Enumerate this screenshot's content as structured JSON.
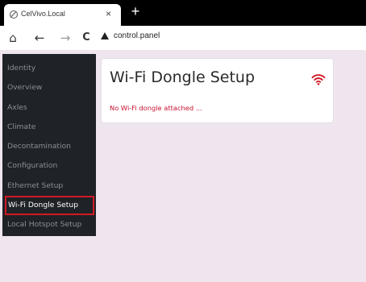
{
  "browser": {
    "tab_title": "CelVivo.Local",
    "tab_close": "×",
    "new_tab": "+",
    "address": "control.panel",
    "home_glyph": "⌂",
    "back_glyph": "←",
    "forward_glyph": "→",
    "reload_glyph": "C"
  },
  "sidebar": {
    "items": [
      {
        "label": "Identity"
      },
      {
        "label": "Overview"
      },
      {
        "label": "Axles"
      },
      {
        "label": "Climate"
      },
      {
        "label": "Decontamination"
      },
      {
        "label": "Configuration"
      },
      {
        "label": "Ethernet Setup"
      },
      {
        "label": "Wi-Fi Dongle Setup"
      },
      {
        "label": "Local Hotspot Setup"
      }
    ],
    "active_index": 7
  },
  "main": {
    "title": "Wi-Fi Dongle Setup",
    "status_icon": "wifi-icon",
    "status_message": "No Wi-Fi dongle attached ..."
  },
  "colors": {
    "accent": "#d11a26",
    "sidebar_bg": "#1f2226",
    "page_bg": "#efe5ef",
    "error_text": "#c8102e"
  }
}
